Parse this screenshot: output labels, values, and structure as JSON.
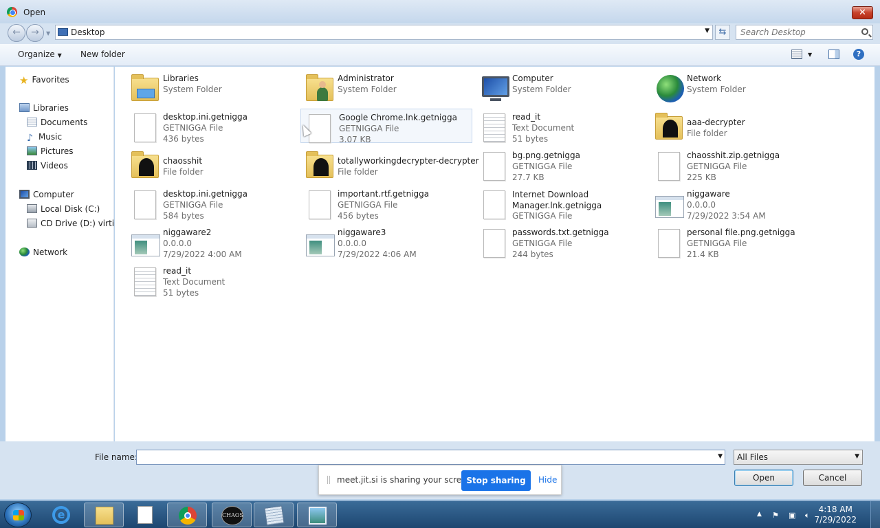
{
  "window": {
    "title": "Open"
  },
  "address": {
    "location": "Desktop",
    "search_placeholder": "Search Desktop"
  },
  "toolbar": {
    "organize": "Organize",
    "new_folder": "New folder"
  },
  "nav": {
    "favorites": "Favorites",
    "libraries": "Libraries",
    "documents": "Documents",
    "music": "Music",
    "pictures": "Pictures",
    "videos": "Videos",
    "computer": "Computer",
    "local_disk": "Local Disk (C:)",
    "cd_drive": "CD Drive (D:) virtio-w",
    "network": "Network"
  },
  "items": [
    {
      "name": "Libraries",
      "line2": "System Folder",
      "line3": "",
      "icon": "libraries-icon"
    },
    {
      "name": "Administrator",
      "line2": "System Folder",
      "line3": "",
      "icon": "user-folder-icon"
    },
    {
      "name": "Computer",
      "line2": "System Folder",
      "line3": "",
      "icon": "computer-icon"
    },
    {
      "name": "Network",
      "line2": "System Folder",
      "line3": "",
      "icon": "network-icon"
    },
    {
      "name": "desktop.ini.getnigga",
      "line2": "GETNIGGA File",
      "line3": "436 bytes",
      "icon": "file-icon"
    },
    {
      "name": "Google Chrome.lnk.getnigga",
      "line2": "GETNIGGA File",
      "line3": "3.07 KB",
      "icon": "file-icon"
    },
    {
      "name": "read_it",
      "line2": "Text Document",
      "line3": "51 bytes",
      "icon": "text-document-icon"
    },
    {
      "name": "aaa-decrypter",
      "line2": "File folder",
      "line3": "",
      "icon": "folder-icon"
    },
    {
      "name": "chaosshit",
      "line2": "File folder",
      "line3": "",
      "icon": "folder-icon"
    },
    {
      "name": "totallyworkingdecrypter-decrypter",
      "line2": "File folder",
      "line3": "",
      "icon": "folder-icon"
    },
    {
      "name": "bg.png.getnigga",
      "line2": "GETNIGGA File",
      "line3": "27.7 KB",
      "icon": "file-icon"
    },
    {
      "name": "chaosshit.zip.getnigga",
      "line2": "GETNIGGA File",
      "line3": "225 KB",
      "icon": "file-icon"
    },
    {
      "name": "desktop.ini.getnigga",
      "line2": "GETNIGGA File",
      "line3": "584 bytes",
      "icon": "file-icon"
    },
    {
      "name": "important.rtf.getnigga",
      "line2": "GETNIGGA File",
      "line3": "456 bytes",
      "icon": "file-icon"
    },
    {
      "name": "Internet Download Manager.lnk.getnigga",
      "line2": "GETNIGGA File",
      "line3": "",
      "icon": "file-icon"
    },
    {
      "name": "niggaware",
      "line2": "0.0.0.0",
      "line3": "7/29/2022 3:54 AM",
      "icon": "application-icon"
    },
    {
      "name": "niggaware2",
      "line2": "0.0.0.0",
      "line3": "7/29/2022 4:00 AM",
      "icon": "application-icon"
    },
    {
      "name": "niggaware3",
      "line2": "0.0.0.0",
      "line3": "7/29/2022 4:06 AM",
      "icon": "application-icon"
    },
    {
      "name": "passwords.txt.getnigga",
      "line2": "GETNIGGA File",
      "line3": "244 bytes",
      "icon": "file-icon"
    },
    {
      "name": "personal file.png.getnigga",
      "line2": "GETNIGGA File",
      "line3": "21.4 KB",
      "icon": "file-icon"
    },
    {
      "name": "read_it",
      "line2": "Text Document",
      "line3": "51 bytes",
      "icon": "text-document-icon"
    }
  ],
  "bottom": {
    "file_name_label": "File name:",
    "file_name_value": "",
    "filter": "All Files",
    "open": "Open",
    "cancel": "Cancel"
  },
  "share_banner": {
    "message": "meet.jit.si is sharing your screen.",
    "stop": "Stop sharing",
    "hide": "Hide"
  },
  "taskbar": {
    "time": "4:18 AM",
    "date": "7/29/2022",
    "chaos_label": "CHAOS"
  }
}
